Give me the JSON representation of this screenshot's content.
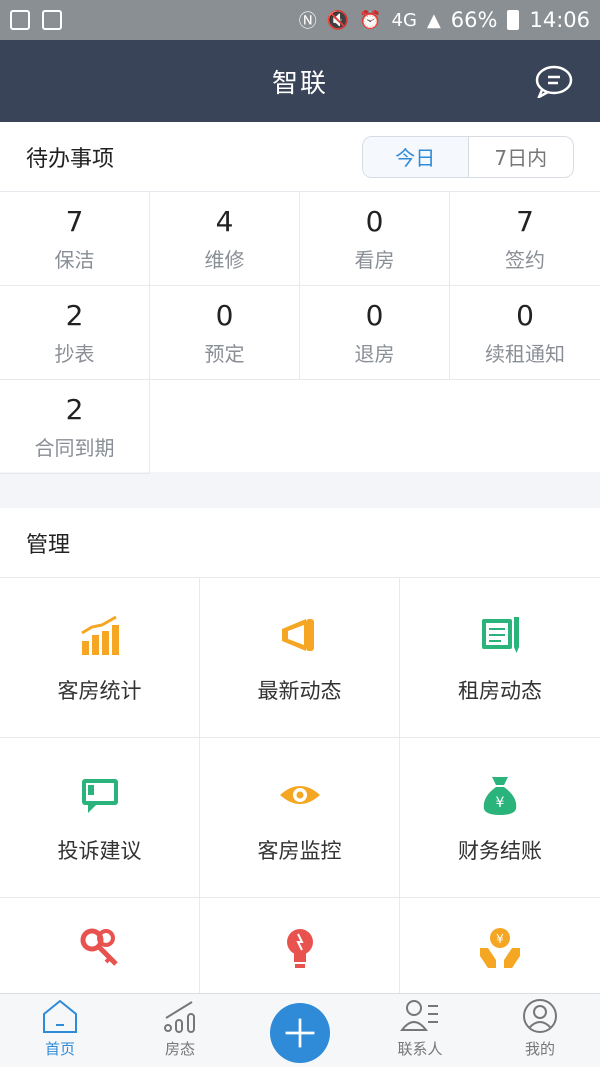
{
  "status_bar": {
    "battery": "66%",
    "time": "14:06",
    "network": "4G"
  },
  "header": {
    "title": "智联"
  },
  "todo": {
    "title": "待办事项",
    "segments": {
      "today": "今日",
      "week": "7日内"
    },
    "items": [
      {
        "count": "7",
        "label": "保洁"
      },
      {
        "count": "4",
        "label": "维修"
      },
      {
        "count": "0",
        "label": "看房"
      },
      {
        "count": "7",
        "label": "签约"
      },
      {
        "count": "2",
        "label": "抄表"
      },
      {
        "count": "0",
        "label": "预定"
      },
      {
        "count": "0",
        "label": "退房"
      },
      {
        "count": "0",
        "label": "续租通知"
      },
      {
        "count": "2",
        "label": "合同到期"
      }
    ]
  },
  "manage": {
    "title": "管理",
    "items": [
      {
        "label": "客房统计",
        "icon": "bar-chart-icon"
      },
      {
        "label": "最新动态",
        "icon": "megaphone-icon"
      },
      {
        "label": "租房动态",
        "icon": "document-pen-icon"
      },
      {
        "label": "投诉建议",
        "icon": "feedback-icon"
      },
      {
        "label": "客房监控",
        "icon": "eye-icon"
      },
      {
        "label": "财务结账",
        "icon": "money-bag-icon"
      },
      {
        "icon": "keys-icon"
      },
      {
        "icon": "lightbulb-icon"
      },
      {
        "icon": "hands-money-icon"
      }
    ]
  },
  "tabbar": {
    "items": [
      {
        "label": "首页"
      },
      {
        "label": "房态"
      },
      {
        "label": ""
      },
      {
        "label": "联系人"
      },
      {
        "label": "我的"
      }
    ]
  },
  "colors": {
    "header": "#3a4458",
    "accent": "#2f8bd8",
    "orange": "#f5a623",
    "green": "#2bb37c",
    "red": "#e8534f"
  }
}
